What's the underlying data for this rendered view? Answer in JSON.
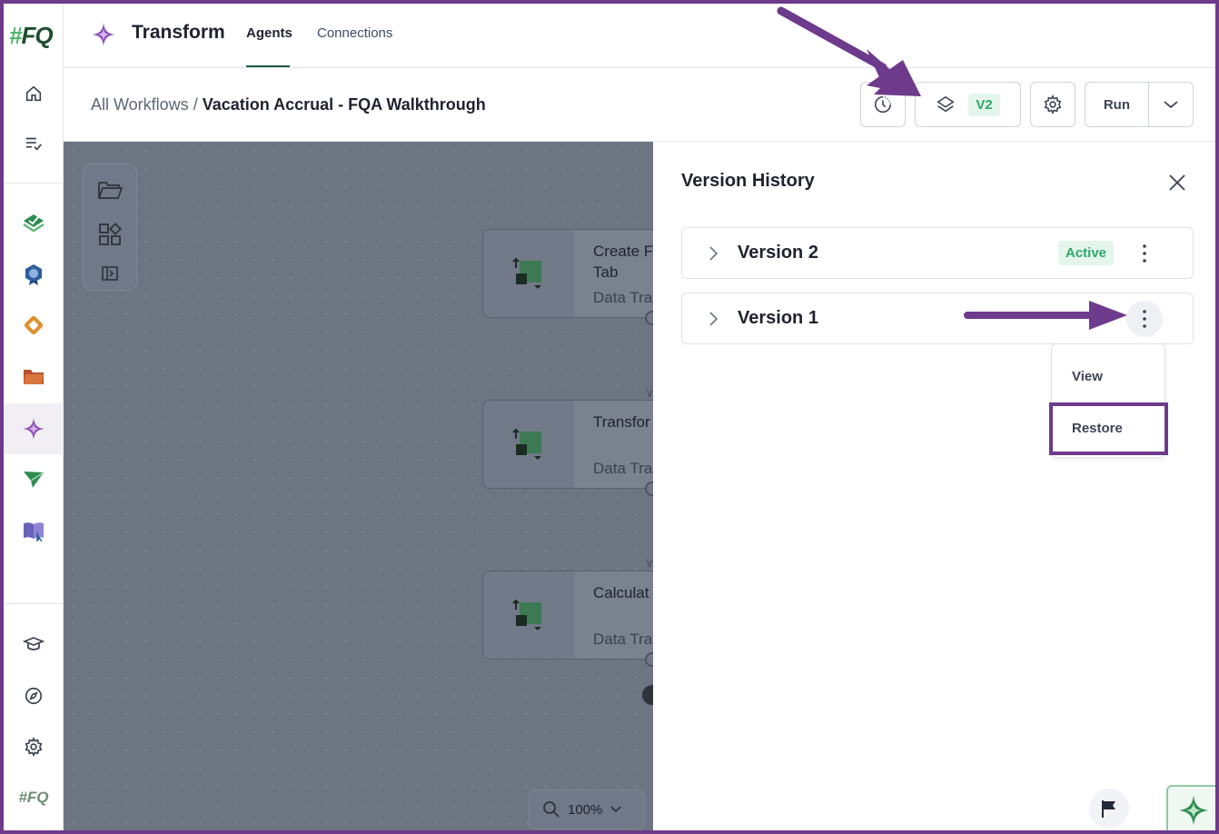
{
  "header": {
    "app_title": "Transform",
    "tabs": [
      {
        "label": "Agents",
        "active": true
      },
      {
        "label": "Connections",
        "active": false
      }
    ]
  },
  "breadcrumb": {
    "parent": "All Workflows",
    "separator": " / ",
    "current": "Vacation Accrual - FQA Walkthrough"
  },
  "toolbar": {
    "version_badge": "V2",
    "run_label": "Run"
  },
  "sidebar": {
    "logo": "#FQ",
    "items": [
      {
        "icon": "home-icon"
      },
      {
        "icon": "task-list-icon"
      },
      {
        "icon": "green-check-stack-icon"
      },
      {
        "icon": "blue-badge-icon"
      },
      {
        "icon": "orange-link-icon"
      },
      {
        "icon": "folder-icon"
      },
      {
        "icon": "transform-sparkle-icon",
        "active": true
      },
      {
        "icon": "paper-plane-icon"
      },
      {
        "icon": "book-icon"
      },
      {
        "icon": "graduation-cap-icon"
      },
      {
        "icon": "compass-icon"
      },
      {
        "icon": "settings-gear-icon"
      }
    ],
    "footer_logo": "#FQ"
  },
  "canvas": {
    "nodes": [
      {
        "title": "Create F\nTab",
        "subtitle": "Data Tra"
      },
      {
        "title": "Transfor",
        "subtitle": "Data Tra"
      },
      {
        "title": "Calculat",
        "subtitle": "Data Tra"
      }
    ],
    "zoom": "100%"
  },
  "version_history": {
    "title": "Version History",
    "versions": [
      {
        "label": "Version 2",
        "status": "Active"
      },
      {
        "label": "Version 1",
        "status": ""
      }
    ],
    "menu": {
      "view_label": "View",
      "restore_label": "Restore"
    }
  },
  "colors": {
    "accent_purple": "#6d3a8c",
    "active_green": "#2ea86a",
    "active_bg": "#e4f6ec",
    "canvas_overlay": "#6e7582"
  }
}
